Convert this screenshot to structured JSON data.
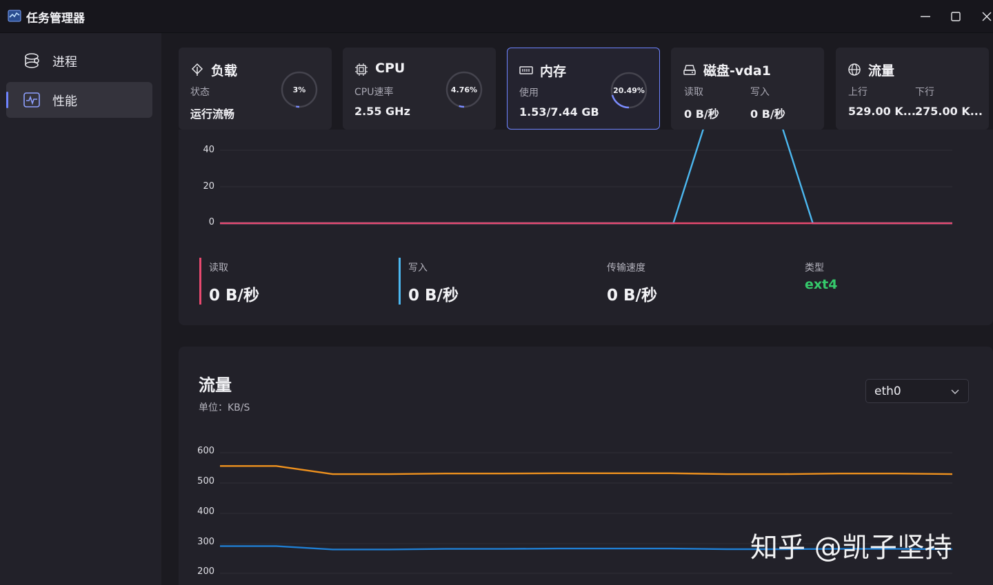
{
  "window": {
    "title": "任务管理器"
  },
  "sidebar": {
    "items": [
      {
        "label": "进程",
        "icon": "process-icon",
        "active": false
      },
      {
        "label": "性能",
        "icon": "performance-icon",
        "active": true
      }
    ]
  },
  "cards": {
    "load": {
      "title": "负载",
      "sub": "状态",
      "value": "运行流畅",
      "percent_label": "3%",
      "percent": 3
    },
    "cpu": {
      "title": "CPU",
      "sub": "CPU速率",
      "value": "2.55 GHz",
      "percent_label": "4.76%",
      "percent": 4.76
    },
    "memory": {
      "title": "内存",
      "sub": "使用",
      "value": "1.53/7.44 GB",
      "percent_label": "20.49%",
      "percent": 20.49
    },
    "disk": {
      "title": "磁盘-vda1",
      "read_label": "读取",
      "write_label": "写入",
      "read_value": "0 B/秒",
      "write_value": "0 B/秒"
    },
    "network": {
      "title": "流量",
      "up_label": "上行",
      "down_label": "下行",
      "up_value": "529.00 K...",
      "down_value": "275.00 K..."
    }
  },
  "disk_panel": {
    "y_ticks": [
      "40",
      "20",
      "0"
    ],
    "stats": [
      {
        "label": "读取",
        "value": "0 B/秒",
        "color": "#e8496f"
      },
      {
        "label": "写入",
        "value": "0 B/秒",
        "color": "#4cb8f0"
      },
      {
        "label": "传输速度",
        "value": "0 B/秒"
      },
      {
        "label": "类型",
        "value": "ext4",
        "color": "#35c96b"
      }
    ]
  },
  "network_panel": {
    "title": "流量",
    "unit": "单位：KB/S",
    "interface": "eth0",
    "y_ticks": [
      "600",
      "500",
      "400",
      "300",
      "200"
    ]
  },
  "chart_data": [
    {
      "type": "line",
      "ylim": [
        0,
        40
      ],
      "series": [
        {
          "values": [
            0,
            0,
            0,
            0,
            0,
            0,
            0,
            0,
            0,
            0,
            0,
            0,
            0,
            0,
            60,
            60,
            60,
            0,
            0,
            0,
            0,
            0
          ],
          "color": "#4cb8f0"
        },
        {
          "values": [
            0,
            0,
            0,
            0,
            0,
            0,
            0,
            0,
            0,
            0,
            0,
            0,
            0,
            0,
            0,
            0,
            0,
            0,
            0,
            0,
            0,
            0
          ],
          "color": "#e8496f"
        }
      ]
    },
    {
      "type": "line",
      "ylim": [
        200,
        600
      ],
      "series": [
        {
          "values": [
            556,
            556,
            529,
            529,
            531,
            531,
            532,
            532,
            532,
            529,
            529,
            531,
            531,
            529
          ],
          "color": "#f0921e"
        },
        {
          "values": [
            290,
            290,
            279,
            279,
            281,
            281,
            282,
            282,
            282,
            280,
            280,
            281,
            281,
            280
          ],
          "color": "#1f7fd4"
        }
      ]
    }
  ],
  "watermark": "知乎 @凯子坚持"
}
